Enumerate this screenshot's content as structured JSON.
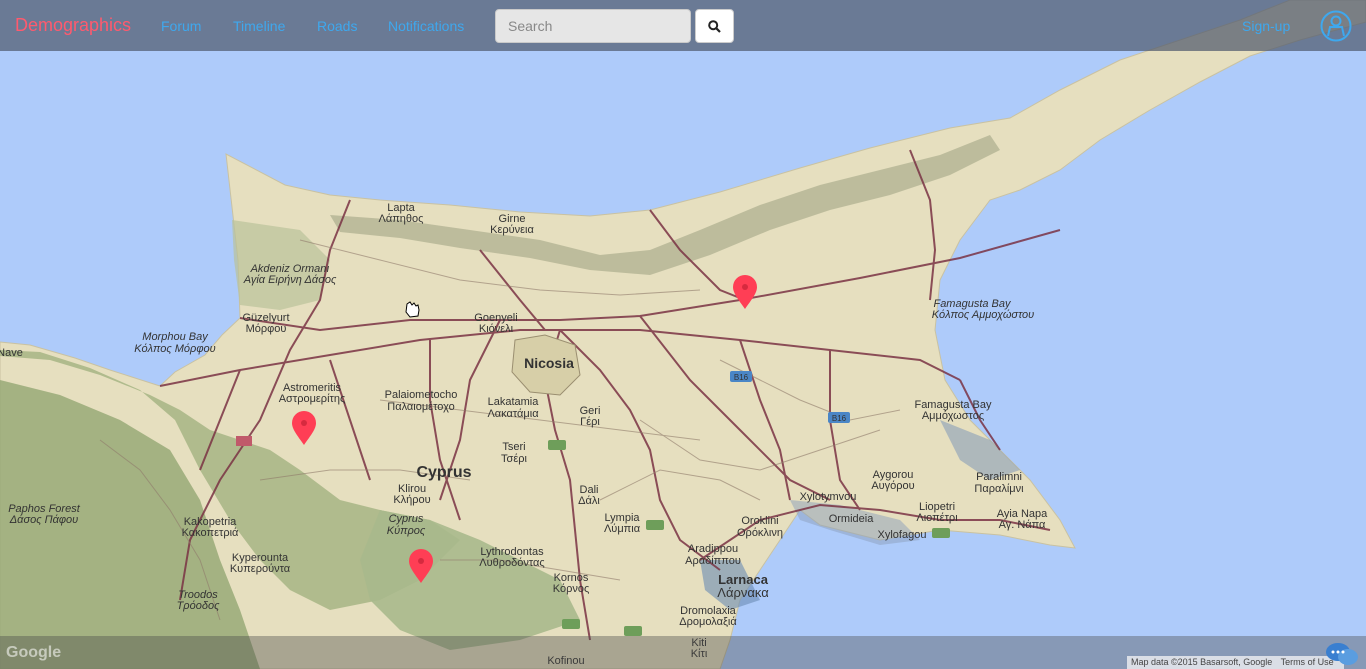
{
  "navbar": {
    "brand": "Demographics",
    "links": [
      "Forum",
      "Timeline",
      "Roads",
      "Notifications"
    ],
    "search_placeholder": "Search",
    "signup": "Sign-up"
  },
  "map": {
    "labels": {
      "lapta": "Lapta",
      "lapta_gr": "Λάπηθος",
      "girne": "Girne",
      "girne_gr": "Κερύνεια",
      "akdeniz": "Akdeniz Ormanı",
      "akdeniz_gr": "Αγία Ειρήνη Δάσος",
      "guzelyurt": "Güzelyurt",
      "guzelyurt_gr": "Μόρφου",
      "morphou_bay": "Morphou Bay",
      "morphou_bay_gr": "Κόλπος Μόρφου",
      "goenyeli": "Goenyeli",
      "goenyeli_gr": "Κιόνελι",
      "nicosia": "Nicosia",
      "astromeritis": "Astromeritis",
      "astromeritis_gr": "Αστρομερίτης",
      "palaiometocho": "Palaiometocho",
      "palaiometocho_gr": "Παλαιομέτοχο",
      "lakatamia": "Lakatamia",
      "lakatamia_gr": "Λακατάμια",
      "geri": "Geri",
      "geri_gr": "Γέρι",
      "tseri": "Tseri",
      "tseri_gr": "Τσέρι",
      "cyprus": "Cyprus",
      "klirou": "Klirou",
      "klirou_gr": "Κλήρου",
      "dali": "Dali",
      "dali_gr": "Δάλι",
      "cyprus_forest": "Cyprus",
      "cyprus_forest_gr": "Κύπρος",
      "famagusta_bay": "Famagusta Bay",
      "famagusta_bay_gr": "Κόλπος Αμμοχώστου",
      "famagusta": "Famagusta Bay",
      "famagusta_gr": "Αμμόχωστος",
      "ayios": "Aygorou",
      "ayios_gr": "Αυγόρου",
      "xylotymvou": "Xylotymvou",
      "ormideia": "Ormideia",
      "liopetri": "Liopetri",
      "liopetri_gr": "Λιοπέτρι",
      "paralimni": "Paralimni",
      "paralimni_gr": "Παραλίμνι",
      "ayia_napa": "Ayia Napa",
      "ayia_napa_gr": "Αγ. Νάπα",
      "xylofagou": "Xylofagou",
      "oroklini": "Oroklini",
      "oroklini_gr": "Ορόκλινη",
      "aradippou": "Aradippou",
      "aradippou_gr": "Αραδίππου",
      "larnaca": "Larnaca",
      "larnaca_gr": "Λάρνακα",
      "lympia": "Lympia",
      "lympia_gr": "Λύμπια",
      "lythrodontas": "Lythrodontas",
      "lythrodontas_gr": "Λυθροδόντας",
      "kornos": "Kornos",
      "kornos_gr": "Κόρνος",
      "dromolaxia": "Dromolaxia",
      "dromolaxia_gr": "Δρομολαξιά",
      "kiti": "Kiti",
      "kiti_gr": "Κίτι",
      "kofinou": "Kofinou",
      "kakopetria": "Kakopetria",
      "kakopetria_gr": "Κακοπετριά",
      "kyperounta": "Kyperounta",
      "kyperounta_gr": "Κυπερούντα",
      "troodos": "Troodos",
      "troodos_gr": "Τρόοδος",
      "paphos_forest": "Paphos Forest",
      "paphos_forest_gr": "Δάσος Πάφου",
      "nave": "Nave",
      "b16_a": "B16",
      "b16_b": "B16"
    },
    "google_logo": "Google",
    "attribution": {
      "data": "Map data ©2015 Basarsoft, Google",
      "terms": "Terms of Use"
    }
  },
  "colors": {
    "land": "#e6dfbf",
    "sea": "#aecbfa",
    "forest": "#a6b584",
    "road": "#7a3344",
    "marker": "#ff3e55",
    "brand": "#ff5a6e",
    "link": "#3ea8ee"
  },
  "icons": {
    "search_button": "search-icon",
    "avatar": "user-circle-icon",
    "markers": "map-pin-icon",
    "chat": "chat-icon"
  }
}
